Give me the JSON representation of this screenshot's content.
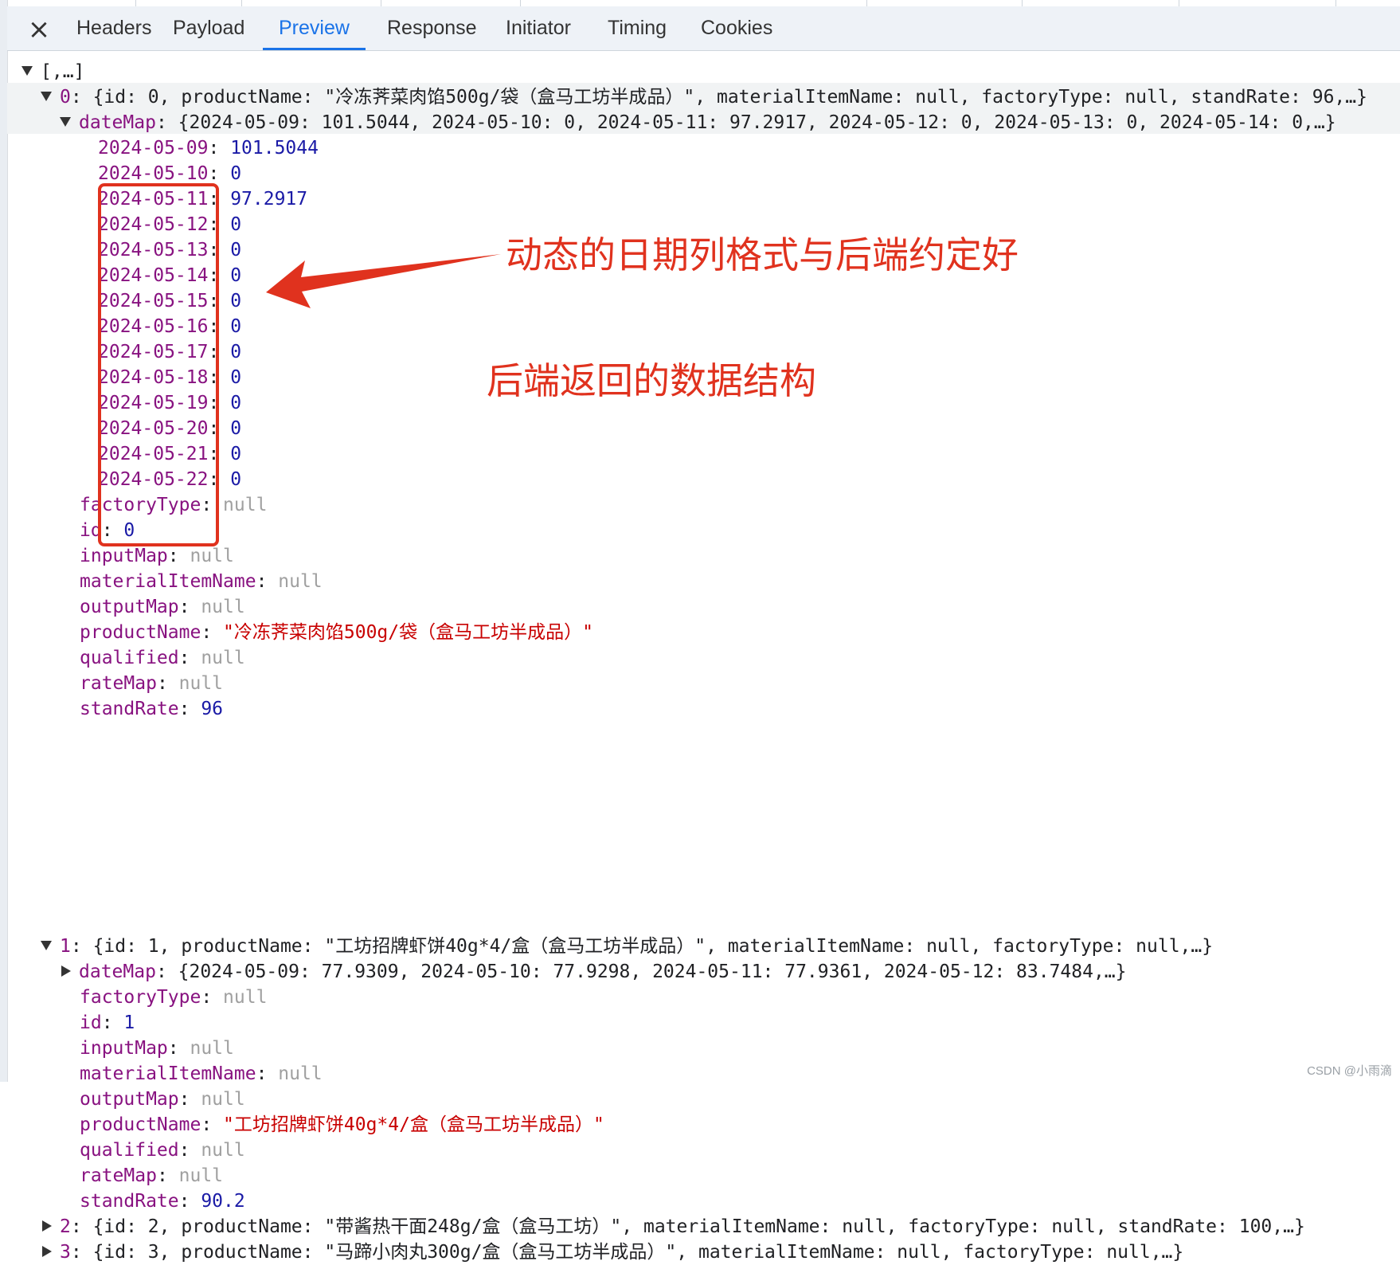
{
  "tabs": {
    "close_icon": "close-icon",
    "items": [
      "Headers",
      "Payload",
      "Preview",
      "Response",
      "Initiator",
      "Timing",
      "Cookies"
    ],
    "active": "Preview"
  },
  "root": {
    "summary": "[,…]"
  },
  "item0": {
    "index": "0",
    "summary": "{id: 0, productName: \"冷冻荠菜肉馅500g/袋（盒马工坊半成品）\", materialItemName: null, factoryType: null, standRate: 96,…}",
    "dateMap_key": "dateMap",
    "dateMap_summary": "{2024-05-09: 101.5044, 2024-05-10: 0, 2024-05-11: 97.2917, 2024-05-12: 0, 2024-05-13: 0, 2024-05-14: 0,…}",
    "dates": [
      {
        "k": "2024-05-09",
        "v": "101.5044"
      },
      {
        "k": "2024-05-10",
        "v": "0"
      },
      {
        "k": "2024-05-11",
        "v": "97.2917"
      },
      {
        "k": "2024-05-12",
        "v": "0"
      },
      {
        "k": "2024-05-13",
        "v": "0"
      },
      {
        "k": "2024-05-14",
        "v": "0"
      },
      {
        "k": "2024-05-15",
        "v": "0"
      },
      {
        "k": "2024-05-16",
        "v": "0"
      },
      {
        "k": "2024-05-17",
        "v": "0"
      },
      {
        "k": "2024-05-18",
        "v": "0"
      },
      {
        "k": "2024-05-19",
        "v": "0"
      },
      {
        "k": "2024-05-20",
        "v": "0"
      },
      {
        "k": "2024-05-21",
        "v": "0"
      },
      {
        "k": "2024-05-22",
        "v": "0"
      }
    ],
    "props": [
      {
        "k": "factoryType",
        "v": "null",
        "t": "nu"
      },
      {
        "k": "id",
        "v": "0",
        "t": "n"
      },
      {
        "k": "inputMap",
        "v": "null",
        "t": "nu"
      },
      {
        "k": "materialItemName",
        "v": "null",
        "t": "nu"
      },
      {
        "k": "outputMap",
        "v": "null",
        "t": "nu"
      },
      {
        "k": "productName",
        "v": "\"冷冻荠菜肉馅500g/袋（盒马工坊半成品）\"",
        "t": "s"
      },
      {
        "k": "qualified",
        "v": "null",
        "t": "nu"
      },
      {
        "k": "rateMap",
        "v": "null",
        "t": "nu"
      },
      {
        "k": "standRate",
        "v": "96",
        "t": "n"
      }
    ]
  },
  "item1": {
    "index": "1",
    "summary": "{id: 1, productName: \"工坊招牌虾饼40g*4/盒（盒马工坊半成品）\", materialItemName: null, factoryType: null,…}",
    "dateMap_key": "dateMap",
    "dateMap_summary": "{2024-05-09: 77.9309, 2024-05-10: 77.9298, 2024-05-11: 77.9361, 2024-05-12: 83.7484,…}",
    "props": [
      {
        "k": "factoryType",
        "v": "null",
        "t": "nu"
      },
      {
        "k": "id",
        "v": "1",
        "t": "n"
      },
      {
        "k": "inputMap",
        "v": "null",
        "t": "nu"
      },
      {
        "k": "materialItemName",
        "v": "null",
        "t": "nu"
      },
      {
        "k": "outputMap",
        "v": "null",
        "t": "nu"
      },
      {
        "k": "productName",
        "v": "\"工坊招牌虾饼40g*4/盒（盒马工坊半成品）\"",
        "t": "s"
      },
      {
        "k": "qualified",
        "v": "null",
        "t": "nu"
      },
      {
        "k": "rateMap",
        "v": "null",
        "t": "nu"
      },
      {
        "k": "standRate",
        "v": "90.2",
        "t": "n"
      }
    ]
  },
  "item2": {
    "index": "2",
    "summary": "{id: 2, productName: \"带酱热干面248g/盒（盒马工坊）\", materialItemName: null, factoryType: null, standRate: 100,…}"
  },
  "item3": {
    "index": "3",
    "summary": "{id: 3, productName: \"马蹄小肉丸300g/盒（盒马工坊半成品）\", materialItemName: null, factoryType: null,…}"
  },
  "annotations": {
    "arrow_text": "动态的日期列格式与后端约定好",
    "structure_text": "后端返回的数据结构",
    "color": "#e0321e"
  },
  "watermark": "CSDN @小雨滴"
}
